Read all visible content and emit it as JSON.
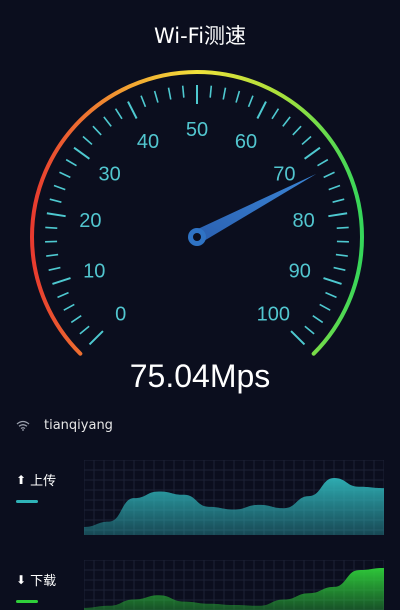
{
  "header": {
    "title": "Wi-Fi测速"
  },
  "gauge": {
    "min": 0,
    "max": 100,
    "labels": [
      "0",
      "10",
      "20",
      "30",
      "40",
      "50",
      "60",
      "70",
      "80",
      "90",
      "100"
    ],
    "needle_value": 73,
    "colors": {
      "tick": "#4ec9d0",
      "label": "#52c6cf",
      "needle": "#2f73c4",
      "arc_start": "#e83a2f",
      "arc_mid": "#f2e23b",
      "arc_end": "#35d65a"
    }
  },
  "speed": {
    "value": "75.04Mps"
  },
  "network": {
    "icon": "wifi-icon",
    "name": "tianqiyang"
  },
  "upload": {
    "label": "上传",
    "arrow": "⬆",
    "color": "#2fb3b8",
    "levels": [
      0.12,
      0.2,
      0.55,
      0.65,
      0.6,
      0.42,
      0.38,
      0.45,
      0.4,
      0.58,
      0.85,
      0.72,
      0.7
    ]
  },
  "download": {
    "label": "下载",
    "arrow": "⬇",
    "color": "#2fcf3a",
    "levels": [
      0.05,
      0.1,
      0.25,
      0.35,
      0.2,
      0.15,
      0.12,
      0.1,
      0.25,
      0.4,
      0.55,
      0.95,
      1.0
    ]
  }
}
